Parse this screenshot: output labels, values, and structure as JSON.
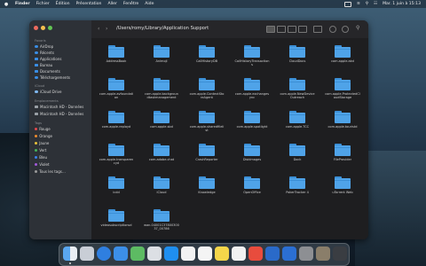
{
  "menubar": {
    "items": [
      "Finder",
      "Fichier",
      "Édition",
      "Présentation",
      "Aller",
      "Fenêtre",
      "Aide"
    ],
    "clock": "Mar. 1 juin à 15:13"
  },
  "sidebar": {
    "favorites_title": "Favoris",
    "favorites": [
      "AirDrop",
      "Récents",
      "Applications",
      "Bureau",
      "Documents",
      "Téléchargements"
    ],
    "icloud_title": "iCloud",
    "icloud": [
      "iCloud Drive"
    ],
    "locations_title": "Emplacements",
    "locations": [
      "Macintosh HD - Données",
      "Macintosh HD - Données"
    ],
    "tags_title": "Tags",
    "tags": [
      {
        "label": "Rouge",
        "color": "#e5484d"
      },
      {
        "label": "Orange",
        "color": "#f08c2e"
      },
      {
        "label": "Jaune",
        "color": "#e9c23a"
      },
      {
        "label": "Vert",
        "color": "#46b35a"
      },
      {
        "label": "Bleu",
        "color": "#3a82f0"
      },
      {
        "label": "Violet",
        "color": "#a259d9"
      },
      {
        "label": "Tous les tags…",
        "color": "#9a9a9a"
      }
    ]
  },
  "toolbar": {
    "path": "/Users/romy/Library/Application Support",
    "back": "‹",
    "forward": "›"
  },
  "folders": [
    "AddressBook",
    "Animoji",
    "CallHistoryDB",
    "CallHistoryTransactions",
    "CloudDocs",
    "com.apple.akd",
    "com.apple.avfoundation",
    "com.apple.backgroundtaskmanagement",
    "com.apple.ContextStoreAgent",
    "com.apple.exchangesync",
    "com.apple.NewDeviceOutreach",
    "com.apple.ProtectedCloudStorage",
    "com.apple.replayd",
    "com.apple.sbd",
    "com.apple.sharedfilelist",
    "com.apple.spotlight",
    "com.apple.TCC",
    "com.apple.touristd",
    "com.apple.transparencyd",
    "com.adobe.chat",
    "CrashReporter",
    "DiskImages",
    "Dock",
    "FileProvider",
    "icdd",
    "iCloud",
    "Knowledge",
    "OpenOffice",
    "PokerTracker 4",
    "uTorrent Web",
    "videosubscriptionsd",
    "wan.04001C3780030037_00786"
  ]
}
